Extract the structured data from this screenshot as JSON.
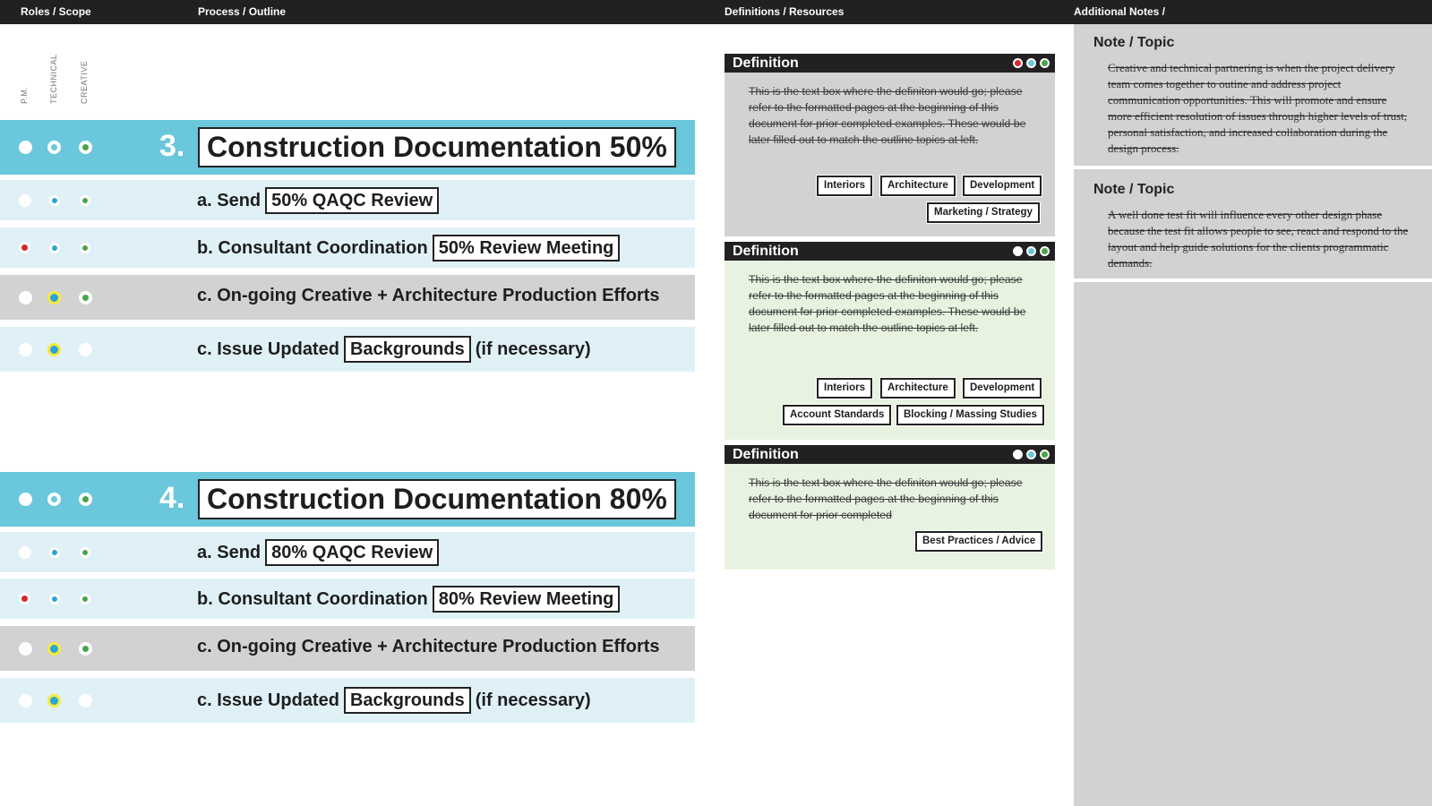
{
  "header": {
    "col1": "Roles / Scope",
    "col2": "Process / Outline",
    "col3": "Definitions / Resources",
    "col4": "Additional Notes /"
  },
  "roles": {
    "pm": "P.M.",
    "technical": "TECHNICAL",
    "creative": "CREATIVE"
  },
  "colors": {
    "blue": "#6ac7dc",
    "light_blue": "#dff1f7",
    "grey": "#d2d2d3",
    "dark": "#222021",
    "red": "#d9262b",
    "green": "#4aa548",
    "yellow": "#f4ea3a",
    "pale_green": "#e7f3e0"
  },
  "sections": [
    {
      "number": "3.",
      "title": "Construction Documentation 50%",
      "a": {
        "prefix": "a. Send",
        "box": "50% QAQC Review"
      },
      "b": {
        "prefix": "b. Consultant Coordination",
        "box": "50% Review Meeting"
      },
      "c1": "c. On-going Creative + Architecture Production Efforts",
      "c2": {
        "prefix": "c. Issue Updated",
        "box": "Backgrounds",
        "suffix": "(if necessary)"
      }
    },
    {
      "number": "4.",
      "title": "Construction Documentation 80%",
      "a": {
        "prefix": "a. Send",
        "box": "80% QAQC Review"
      },
      "b": {
        "prefix": "b. Consultant Coordination",
        "box": "80% Review Meeting"
      },
      "c1": "c. On-going Creative + Architecture Production Efforts",
      "c2": {
        "prefix": "c. Issue Updated",
        "box": "Backgrounds",
        "suffix": "(if necessary)"
      }
    }
  ],
  "definitions": [
    {
      "title": "Definition",
      "text": "This is the text box where the definiton would go; please refer to the formatted pages at the beginning of this document for prior completed examples. These would be later filled out to match the outline topics at left.",
      "tags": [
        "Interiors",
        "Architecture",
        "Development",
        "Marketing / Strategy"
      ]
    },
    {
      "title": "Definition",
      "text": "This is the text box where the definiton would go; please refer to the formatted pages at the beginning of this document for prior completed examples. These would be later filled out to match the outline topics at left.",
      "tags": [
        "Interiors",
        "Architecture",
        "Development",
        "Account Standards",
        "Blocking / Massing Studies"
      ]
    },
    {
      "title": "Definition",
      "text": "This is the text box where the definiton would go; please refer to the formatted pages at the beginning of this document for prior completed",
      "tags": [
        "Best Practices / Advice"
      ]
    }
  ],
  "notes": [
    {
      "title": "Note / Topic",
      "text": "Creative and technical partnering is when the project delivery team comes together to outine and address project communication opportunities. This will promote and ensure more efficient resolution of issues through higher levels of trust, personal satisfaction, and increased collaboration during the design process."
    },
    {
      "title": "Note / Topic",
      "text": "A well done test fit will influence every other design phase because the test fit allows people to see, react and respond to the layout and help guide solutions for the clients programmatic demands."
    }
  ]
}
